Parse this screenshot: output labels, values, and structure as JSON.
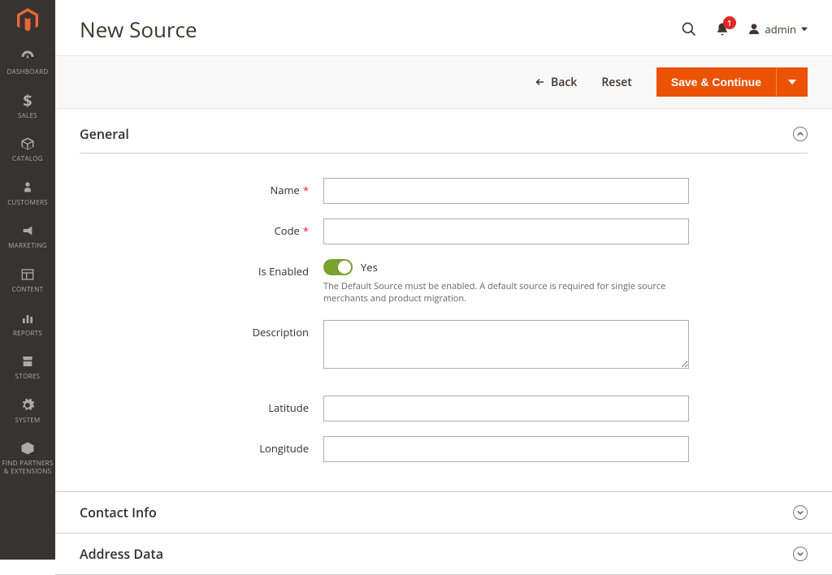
{
  "sidebar": {
    "items": [
      {
        "label": "Dashboard"
      },
      {
        "label": "Sales"
      },
      {
        "label": "Catalog"
      },
      {
        "label": "Customers"
      },
      {
        "label": "Marketing"
      },
      {
        "label": "Content"
      },
      {
        "label": "Reports"
      },
      {
        "label": "Stores"
      },
      {
        "label": "System"
      },
      {
        "label": "Find Partners & Extensions"
      }
    ]
  },
  "header": {
    "title": "New Source",
    "notification_count": "1",
    "user": "admin"
  },
  "actions": {
    "back": "Back",
    "reset": "Reset",
    "save": "Save & Continue"
  },
  "sections": {
    "general": {
      "title": "General",
      "fields": {
        "name_label": "Name",
        "code_label": "Code",
        "enabled_label": "Is Enabled",
        "enabled_value": "Yes",
        "enabled_help": "The Default Source must be enabled. A default source is required for single source merchants and product migration.",
        "description_label": "Description",
        "latitude_label": "Latitude",
        "longitude_label": "Longitude"
      }
    },
    "contact": {
      "title": "Contact Info"
    },
    "address": {
      "title": "Address Data"
    }
  }
}
